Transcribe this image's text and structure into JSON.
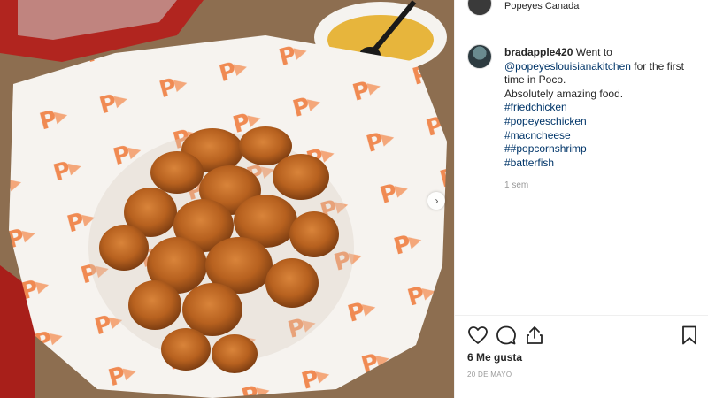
{
  "header": {
    "subtitle": "Popeyes Canada"
  },
  "post": {
    "image_description_icon": "photo-of-popcorn-shrimp",
    "next_icon": "chevron-right-icon"
  },
  "caption": {
    "username": "bradapple420",
    "text_before": " Went to ",
    "mention": "@popeyeslouisianakitchen",
    "text_after": " for the first time in Poco.",
    "line2": "Absolutely amazing food.",
    "hashtags": [
      "#friedchicken",
      "#popeyeschicken",
      "#macncheese",
      "##popcornshrimp",
      "#batterfish"
    ],
    "time": "1 sem"
  },
  "actions": {
    "like_icon": "heart-icon",
    "comment_icon": "comment-bubble-icon",
    "share_icon": "share-icon",
    "save_icon": "bookmark-icon",
    "likes": "6 Me gusta",
    "date": "20 DE MAYO"
  },
  "colors": {
    "link": "#003569",
    "muted": "#999999",
    "brand_orange": "#f26522"
  }
}
